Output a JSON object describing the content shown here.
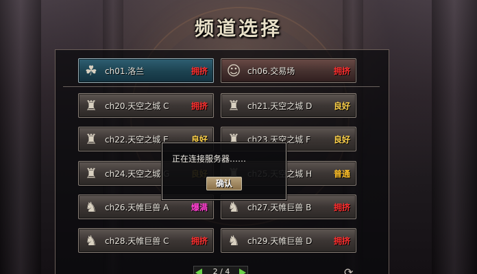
{
  "title": "频道选择",
  "channels": [
    {
      "name": "ch01.洛兰",
      "status": "拥挤",
      "icon": "herb-icon"
    },
    {
      "name": "ch06.交易场",
      "status": "拥挤",
      "icon": "merchant-icon"
    },
    {
      "name": "ch20.天空之城 C",
      "status": "拥挤",
      "icon": "armor-icon"
    },
    {
      "name": "ch21.天空之城 D",
      "status": "良好",
      "icon": "armor-icon"
    },
    {
      "name": "ch22.天空之城 E",
      "status": "良好",
      "icon": "armor-icon"
    },
    {
      "name": "ch23.天空之城 F",
      "status": "良好",
      "icon": "armor-icon"
    },
    {
      "name": "ch24.天空之城 G",
      "status": "良好",
      "icon": "armor-icon"
    },
    {
      "name": "ch25.天空之城 H",
      "status": "普通",
      "icon": "armor-icon"
    },
    {
      "name": "ch26.天帷巨兽 A",
      "status": "爆满",
      "icon": "beast-icon"
    },
    {
      "name": "ch27.天帷巨兽 B",
      "status": "拥挤",
      "icon": "beast-icon"
    },
    {
      "name": "ch28.天帷巨兽 C",
      "status": "拥挤",
      "icon": "beast-icon"
    },
    {
      "name": "ch29.天帷巨兽 D",
      "status": "拥挤",
      "icon": "beast-icon"
    }
  ],
  "dialog": {
    "message": "正在连接服务器……",
    "confirm_label": "确认"
  },
  "pager": {
    "text": "2 / 4"
  }
}
